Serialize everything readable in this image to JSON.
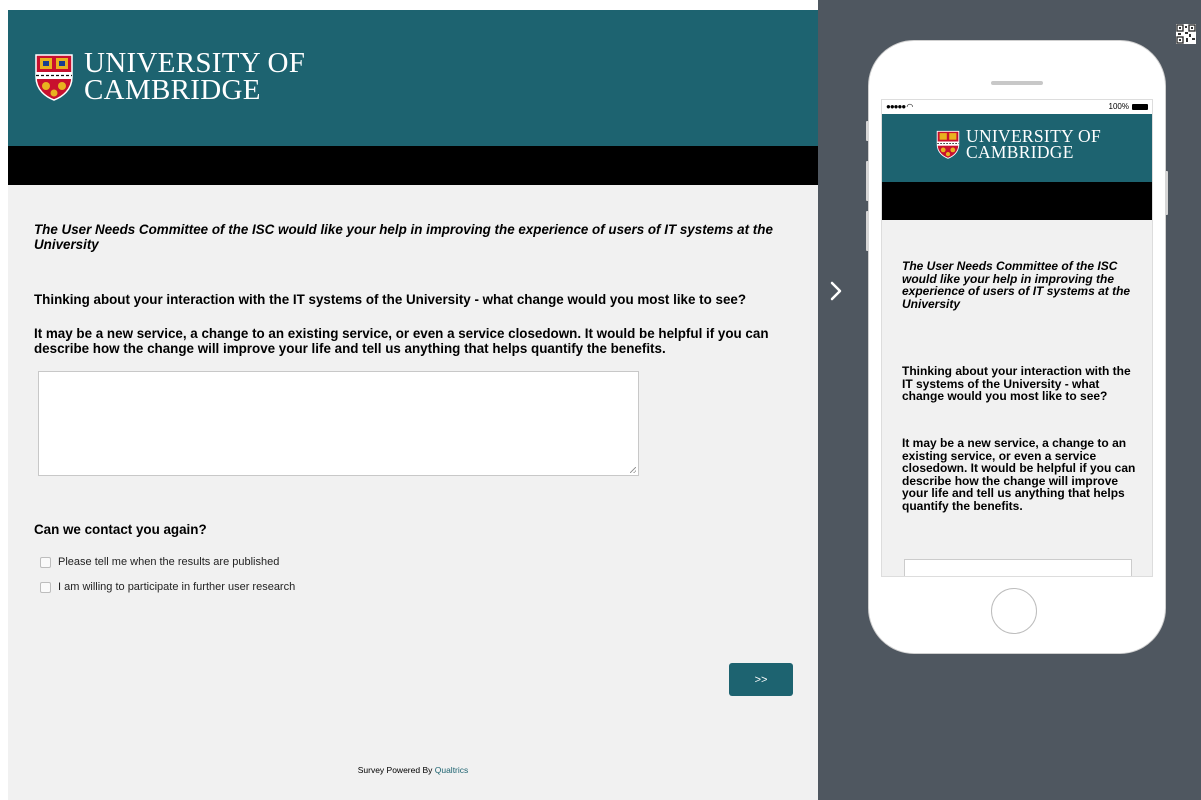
{
  "brand": {
    "line1": "UNIVERSITY OF",
    "line2": "CAMBRIDGE",
    "colors": {
      "teal": "#1d6370",
      "background": "#f1f1f1",
      "preview_bg": "#4f5760"
    }
  },
  "survey": {
    "intro": "The User Needs Committee of the ISC would like your help in improving the experience of users of IT systems at the University",
    "question1": "Thinking about your interaction with the IT systems of the University - what change would you most like to see?",
    "question1_detail": "It may be a new service, a change to an existing service, or even a service closedown. It would be helpful if you can describe how the change will improve your life and tell us anything that helps quantify the benefits.",
    "answer_value": "",
    "contact_question": "Can we contact you again?",
    "options": [
      {
        "label": "Please tell me when the results are published",
        "checked": false
      },
      {
        "label": "I am willing to participate in further user research",
        "checked": false
      }
    ],
    "next_label": ">>",
    "footer_prefix": "Survey Powered By ",
    "footer_link": "Qualtrics"
  },
  "mobile_preview": {
    "status_signal": "●●●●● ",
    "status_battery": "100%",
    "icons": [
      "qr-code-icon",
      "chevron-right-icon",
      "wifi-icon",
      "battery-icon",
      "cambridge-shield-icon"
    ]
  }
}
